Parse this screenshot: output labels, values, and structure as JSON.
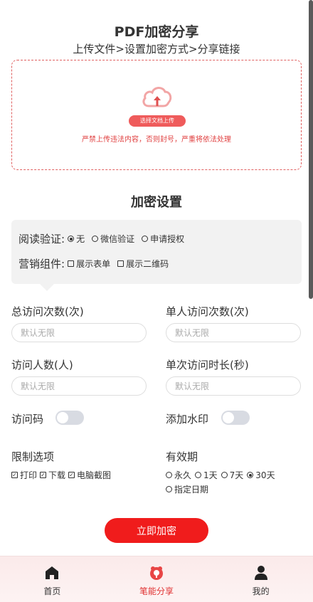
{
  "header": {
    "title": "PDF加密分享",
    "subtitle": "上传文件>设置加密方式>分享链接"
  },
  "upload": {
    "icon": "cloud-upload-icon",
    "button_label": "选择文档上传",
    "warning": "严禁上传违法内容，否则封号，严重将依法处理"
  },
  "encryption": {
    "section_title": "加密设置",
    "read_verify": {
      "label": "阅读验证:",
      "options": [
        "无",
        "微信验证",
        "申请授权"
      ],
      "selected": "无"
    },
    "marketing": {
      "label": "营销组件:",
      "options": [
        "展示表单",
        "展示二维码"
      ]
    }
  },
  "fields": {
    "total_visits": {
      "label": "总访问次数(次)",
      "placeholder": "默认无限"
    },
    "single_visits": {
      "label": "单人访问次数(次)",
      "placeholder": "默认无限"
    },
    "visitors": {
      "label": "访问人数(人)",
      "placeholder": "默认无限"
    },
    "duration": {
      "label": "单次访问时长(秒)",
      "placeholder": "默认无限"
    }
  },
  "toggles": {
    "access_code": {
      "label": "访问码",
      "on": false
    },
    "watermark": {
      "label": "添加水印",
      "on": false
    }
  },
  "restrictions": {
    "label": "限制选项",
    "options": [
      "打印",
      "下载",
      "电脑截图"
    ]
  },
  "validity": {
    "label": "有效期",
    "options": [
      "永久",
      "1天",
      "7天",
      "30天",
      "指定日期"
    ],
    "selected": "30天"
  },
  "submit_label": "立即加密",
  "tabbar": {
    "items": [
      {
        "label": "首页",
        "icon": "home-icon",
        "active": false
      },
      {
        "label": "笔能分享",
        "icon": "share-icon",
        "active": true
      },
      {
        "label": "我的",
        "icon": "user-icon",
        "active": false
      }
    ]
  },
  "colors": {
    "accent": "#f01c1c",
    "warning": "#e04040"
  }
}
